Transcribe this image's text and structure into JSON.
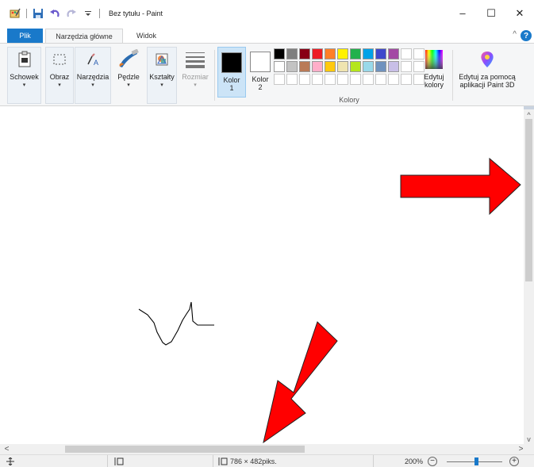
{
  "window": {
    "title": "Bez tytułu - Paint",
    "minimize_glyph": "–",
    "maximize_glyph": "☐",
    "close_glyph": "✕"
  },
  "tabs": {
    "file": "Plik",
    "home": "Narzędzia główne",
    "view": "Widok",
    "help": "?",
    "collapse_glyph": "^"
  },
  "ribbon": {
    "clipboard": "Schowek",
    "image": "Obraz",
    "tools": "Narzędzia",
    "brushes": "Pędzle",
    "shapes": "Kształty",
    "size": "Rozmiar",
    "color1_line1": "Kolor",
    "color1_line2": "1",
    "color2_line1": "Kolor",
    "color2_line2": "2",
    "edit_colors_line1": "Edytuj",
    "edit_colors_line2": "kolory",
    "colors_group": "Kolory",
    "paint3d_line1": "Edytuj za pomocą",
    "paint3d_line2": "aplikacji Paint 3D",
    "dropdown_glyph": "▾"
  },
  "colors": {
    "color1": "#000000",
    "color2": "#ffffff",
    "palette_row1": [
      "#000000",
      "#7f7f7f",
      "#880015",
      "#ed1c24",
      "#ff7f27",
      "#fff200",
      "#22b14c",
      "#00a2e8",
      "#3f48cc",
      "#a349a4"
    ],
    "palette_row2": [
      "#ffffff",
      "#c3c3c3",
      "#b97a57",
      "#ffaec9",
      "#ffc90e",
      "#efe4b0",
      "#b5e61d",
      "#99d9ea",
      "#7092be",
      "#c8bfe7"
    ],
    "palette_cols": 12,
    "palette_row3_empty": 12,
    "arrow_fill": "#ff0000",
    "accent": "#1979ca"
  },
  "statusbar": {
    "canvas_size": "786 × 482piks.",
    "zoom": "200%",
    "zoom_out": "−",
    "zoom_in": "+",
    "zoom_fraction": 0.5
  },
  "scroll": {
    "up": "^",
    "down": "v",
    "left": "<",
    "right": ">"
  }
}
